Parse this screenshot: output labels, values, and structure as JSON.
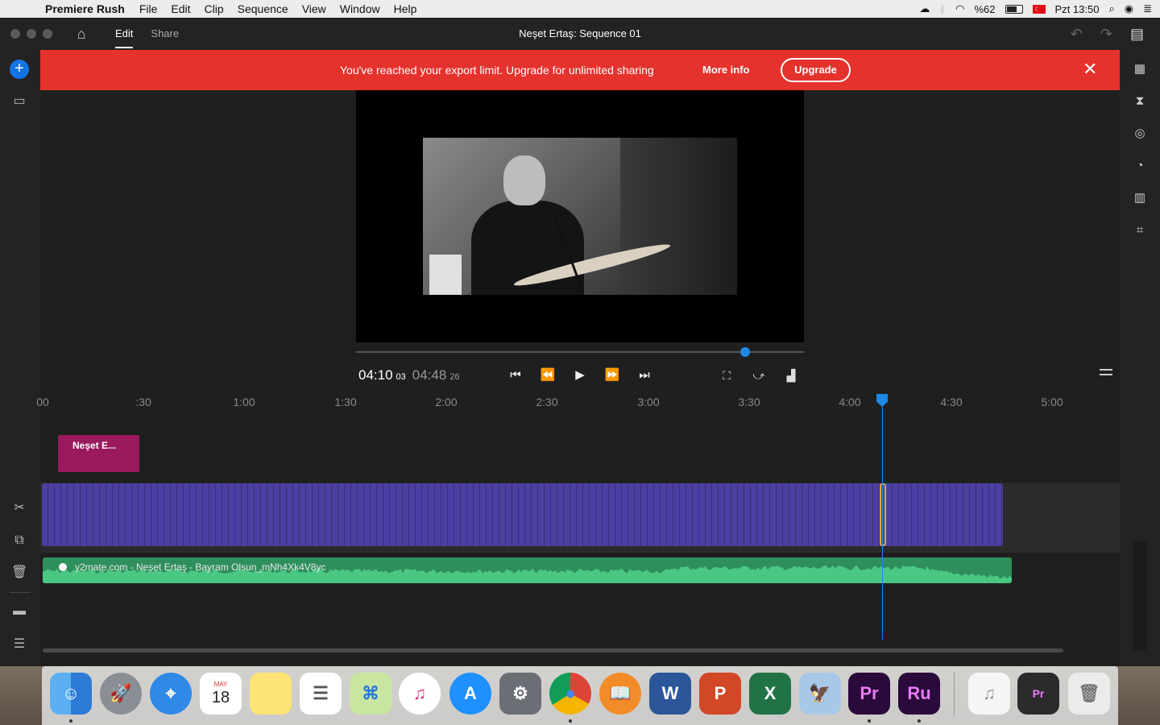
{
  "menubar": {
    "apple": "",
    "app_name": "Premiere Rush",
    "items": [
      "File",
      "Edit",
      "Clip",
      "Sequence",
      "View",
      "Window",
      "Help"
    ],
    "battery": "%62",
    "clock": "Pzt 13:50"
  },
  "titlebar": {
    "tabs": [
      "Edit",
      "Share"
    ],
    "sequence_title": "Neşet Ertaş: Sequence 01"
  },
  "banner": {
    "message": "You've reached your export limit. Upgrade for unlimited sharing",
    "more_info": "More info",
    "upgrade": "Upgrade",
    "close": "✕",
    "color": "#e5322d"
  },
  "player": {
    "current_time": "04:10",
    "current_frames": "03",
    "total_time": "04:48",
    "total_frames": "26",
    "progress": 0.868
  },
  "timeline": {
    "ruler_labels": [
      "00",
      ":30",
      "1:00",
      "1:30",
      "2:00",
      "2:30",
      "3:00",
      "3:30",
      "4:00",
      "4:30",
      "5:00"
    ],
    "title_clip": "Neşet E...",
    "audio_clip": "y2mate.com - Neşet Ertaş - Bayram Olsun_mNh4Xk4V8yc",
    "playhead_time": "04:10",
    "colors": {
      "video": "#4b3fa3",
      "audio": "#2f8f5c",
      "title": "#9b1a5e",
      "playhead": "#1e88e5"
    }
  },
  "dock": {
    "apps": [
      {
        "name": "Finder",
        "label": "☺"
      },
      {
        "name": "Launchpad",
        "label": "🚀"
      },
      {
        "name": "Safari",
        "label": "⌖"
      },
      {
        "name": "Calendar",
        "label": "18",
        "month": "MAY"
      },
      {
        "name": "Notes",
        "label": ""
      },
      {
        "name": "Reminders",
        "label": "☰"
      },
      {
        "name": "Maps",
        "label": "⌘"
      },
      {
        "name": "iTunes",
        "label": "♫"
      },
      {
        "name": "App Store",
        "label": "A"
      },
      {
        "name": "System Preferences",
        "label": "⚙"
      },
      {
        "name": "Chrome",
        "label": "●"
      },
      {
        "name": "iBooks",
        "label": "📖"
      },
      {
        "name": "Word",
        "label": "W"
      },
      {
        "name": "PowerPoint",
        "label": "P"
      },
      {
        "name": "Excel",
        "label": "X"
      },
      {
        "name": "Preview",
        "label": "🦅"
      },
      {
        "name": "Premiere Pro",
        "label": "Pr"
      },
      {
        "name": "Premiere Rush",
        "label": "Ru"
      },
      {
        "name": "Music",
        "label": "♫"
      },
      {
        "name": "Media Encoder",
        "label": "Pr"
      },
      {
        "name": "Trash",
        "label": "🗑"
      }
    ]
  }
}
